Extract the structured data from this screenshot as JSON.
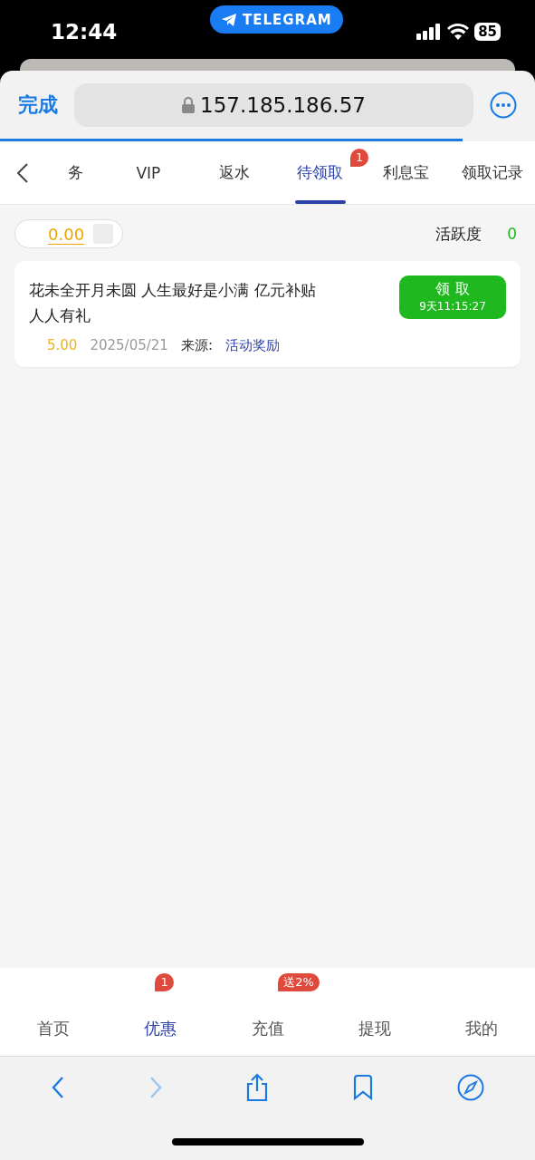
{
  "status_bar": {
    "time": "12:44",
    "app_pill": "TELEGRAM",
    "battery": "85"
  },
  "browser": {
    "done": "完成",
    "url": "157.185.186.57",
    "progress": {
      "level": 0.865
    }
  },
  "tabs": [
    {
      "label": "务",
      "selected": false
    },
    {
      "label": "VIP",
      "selected": false
    },
    {
      "label": "返水",
      "selected": false
    },
    {
      "label": "待领取",
      "selected": true,
      "badge": "1"
    },
    {
      "label": "利息宝",
      "selected": false
    },
    {
      "label": "领取记录",
      "selected": false
    }
  ],
  "summary": {
    "amount": "0.00",
    "activity_label": "活跃度",
    "activity_value": "0"
  },
  "rewards": [
    {
      "title": "花未全开月未圆 人生最好是小满 亿元补贴人人有礼",
      "amount": "5.00",
      "date": "2025/05/21",
      "source_label": "来源:",
      "source": "活动奖励",
      "button": "领 取",
      "countdown": "9天11:15:27"
    }
  ],
  "bottom_nav": [
    {
      "label": "首页",
      "selected": false
    },
    {
      "label": "优惠",
      "selected": true,
      "badge": "1"
    },
    {
      "label": "充值",
      "selected": false,
      "badge": "送2%"
    },
    {
      "label": "提现",
      "selected": false
    },
    {
      "label": "我的",
      "selected": false
    }
  ],
  "toolbar": {
    "forward_disabled": true
  }
}
